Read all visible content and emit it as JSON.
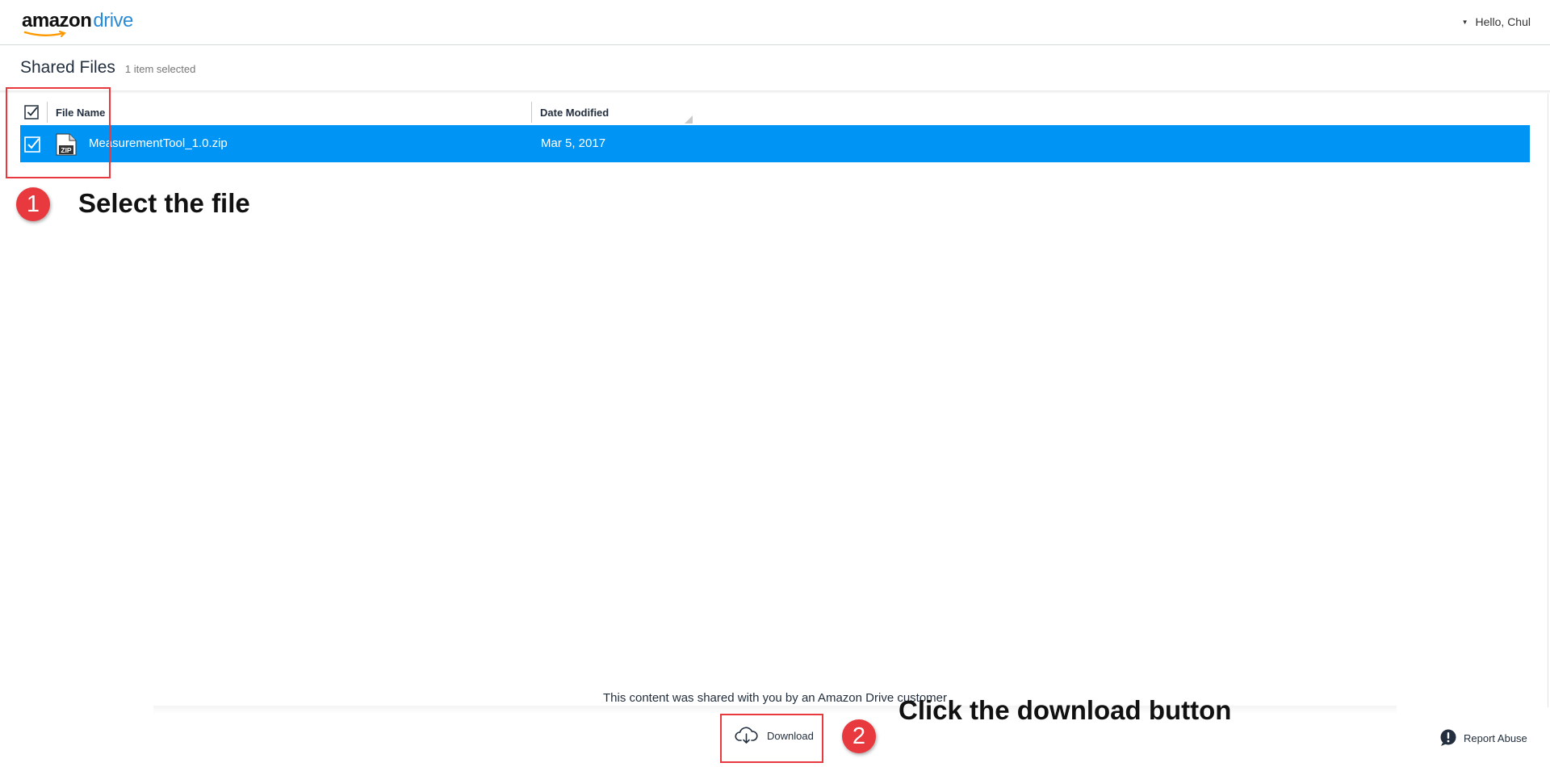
{
  "header": {
    "logo_word": "amazon",
    "logo_product": "drive",
    "greeting": "Hello, Chul"
  },
  "page": {
    "title": "Shared Files",
    "selection_count": "1 item selected"
  },
  "table": {
    "columns": [
      "File Name",
      "Date Modified"
    ],
    "rows": [
      {
        "name": "MeasurementTool_1.0.zip",
        "date": "Mar 5, 2017",
        "icon": "zip-file-icon",
        "selected": true
      }
    ]
  },
  "annotations": {
    "step1_number": "1",
    "step1_text": "Select the file",
    "step2_number": "2",
    "step2_text": "Click the download button"
  },
  "footer": {
    "share_note": "This content was shared with you by an Amazon Drive customer",
    "download_label": "Download",
    "report_label": "Report Abuse"
  },
  "colors": {
    "selected_row": "#0095f5",
    "brand_blue": "#2a8bd6",
    "annotation_red": "#e8393f"
  }
}
